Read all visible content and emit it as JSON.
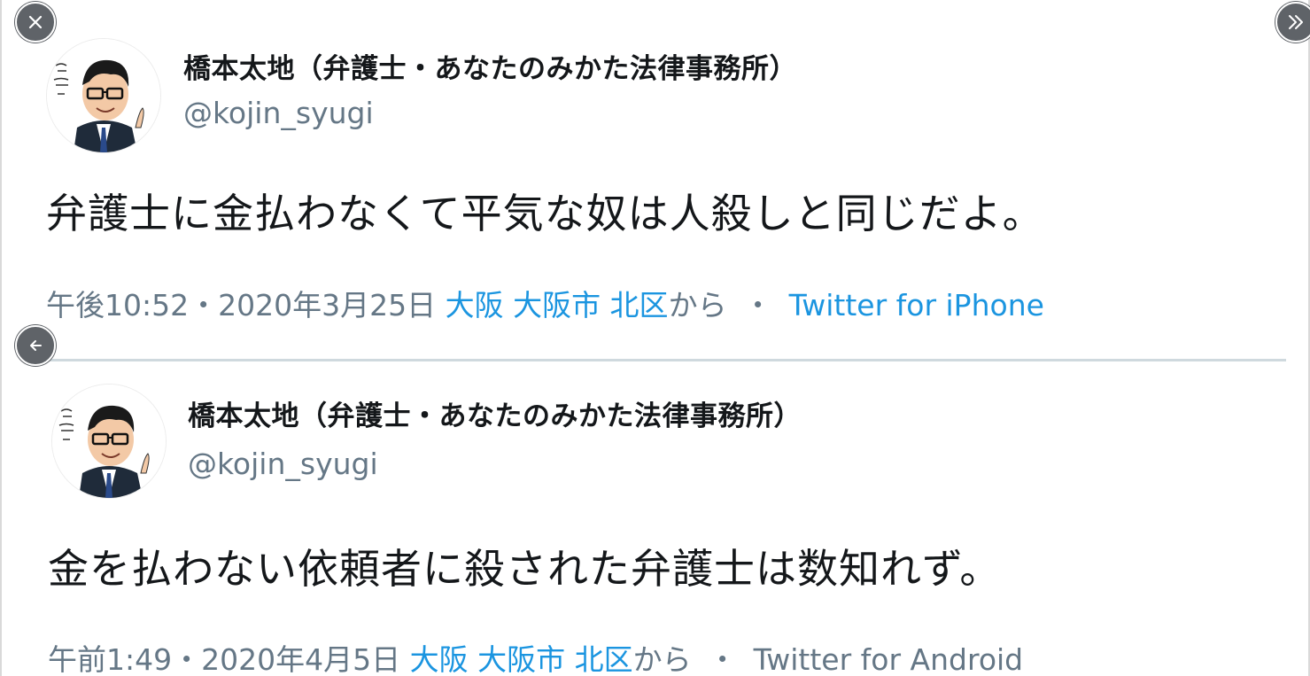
{
  "tweets": [
    {
      "author": {
        "display_name": "橋本太地（弁護士・あなたのみかた法律事務所）",
        "handle": "@kojin_syugi"
      },
      "text": "弁護士に金払わなくて平気な奴は人殺しと同じだよ。",
      "timestamp": "午後10:52・2020年3月25日",
      "location": "大阪 大阪市 北区",
      "from_suffix": "から",
      "separator": "・",
      "client": "Twitter for iPhone"
    },
    {
      "author": {
        "display_name": "橋本太地（弁護士・あなたのみかた法律事務所）",
        "handle": "@kojin_syugi"
      },
      "text": "金を払わない依頼者に殺された弁護士は数知れず。",
      "timestamp": "午前1:49・2020年4月5日",
      "location": "大阪 大阪市 北区",
      "from_suffix": "から",
      "separator": "・",
      "client": "Twitter for Android"
    }
  ],
  "controls": {
    "close_icon": "close-icon",
    "next_icon": "double-chevron-right-icon",
    "back_icon": "arrow-left-icon"
  },
  "colors": {
    "name": "#14171a",
    "secondary": "#657786",
    "link": "#1b95e0",
    "divider": "#cfd9de",
    "overlay_button": "#5f6368"
  }
}
